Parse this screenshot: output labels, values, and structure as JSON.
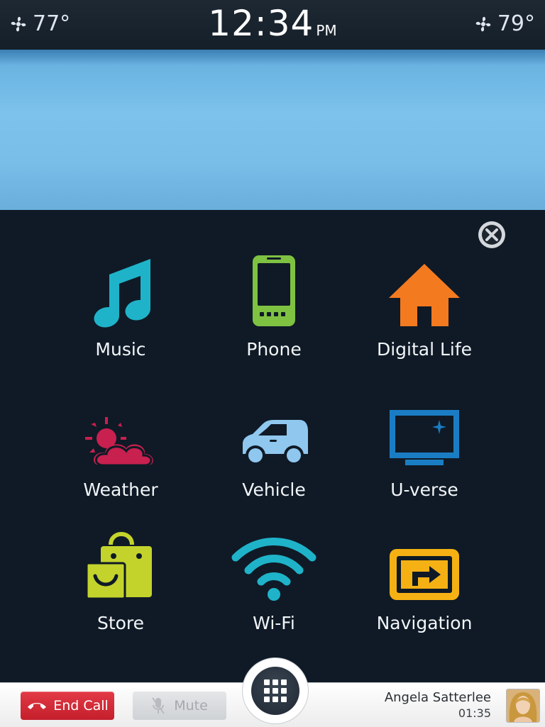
{
  "status": {
    "climate_left": "77°",
    "climate_right": "79°",
    "time": "12:34",
    "ampm": "PM",
    "fan_icon": "fan-icon"
  },
  "apps": [
    {
      "label": "Music",
      "icon": "music-note-icon",
      "color": "#1fb3c9"
    },
    {
      "label": "Phone",
      "icon": "phone-icon",
      "color": "#7fc242"
    },
    {
      "label": "Digital Life",
      "icon": "home-icon",
      "color": "#f47a20"
    },
    {
      "label": "Weather",
      "icon": "weather-icon",
      "color": "#c8204f"
    },
    {
      "label": "Vehicle",
      "icon": "car-icon",
      "color": "#8fc7ef"
    },
    {
      "label": "U-verse",
      "icon": "tv-icon",
      "color": "#1a7dc4"
    },
    {
      "label": "Store",
      "icon": "shopping-bag-icon",
      "color": "#c3d32c"
    },
    {
      "label": "Wi-Fi",
      "icon": "wifi-icon",
      "color": "#1fb3c9"
    },
    {
      "label": "Navigation",
      "icon": "navigation-icon",
      "color": "#f5b114"
    }
  ],
  "callbar": {
    "end_call_label": "End Call",
    "mute_label": "Mute",
    "caller_name": "Angela Satterlee",
    "call_duration": "01:35"
  }
}
